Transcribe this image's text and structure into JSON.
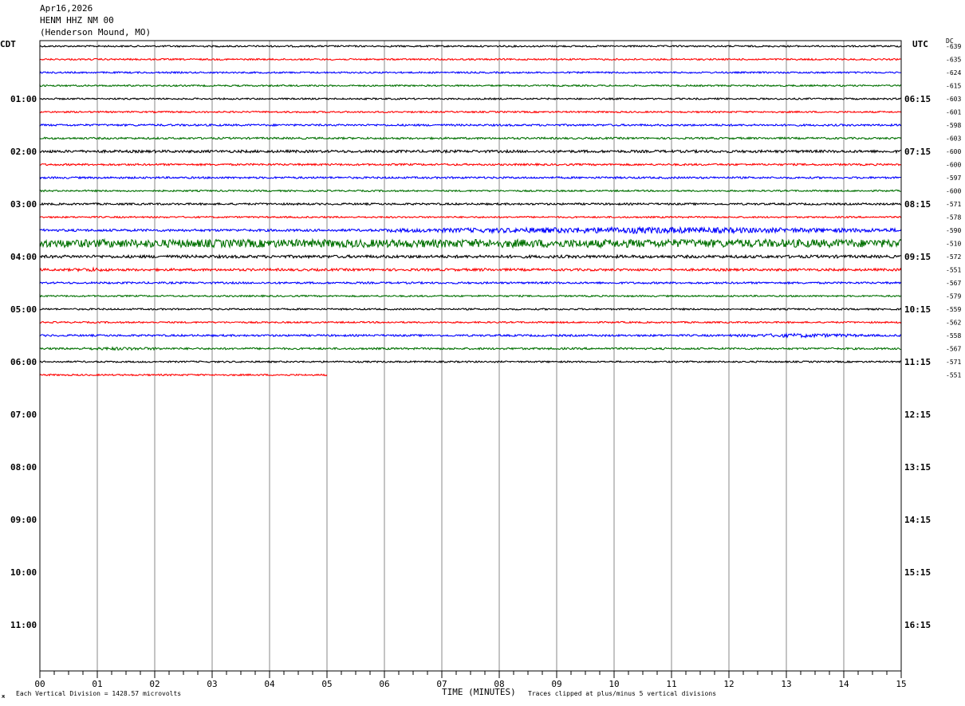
{
  "header": {
    "date": "Apr16,2026",
    "station": "HENM HHZ NM 00",
    "location": "(Henderson Mound, MO)"
  },
  "left_tz_label": "CDT",
  "right_tz_label": "UTC",
  "dc_label": "DC",
  "footer": {
    "vertical_division": "Each Vertical Division = 1428.57 microvolts",
    "axis_title": "TIME (MINUTES)",
    "clipping_note": "Traces clipped at plus/minus 5 vertical divisions",
    "logo_mark": "ж"
  },
  "colors": {
    "trace_cycle": [
      "#000000",
      "#ff0000",
      "#0000ff",
      "#007000"
    ],
    "grid": "#888888",
    "frame": "#000000"
  },
  "chart_data": {
    "type": "line",
    "subtype": "helicorder",
    "x_axis": {
      "label": "TIME (MINUTES)",
      "range": [
        0,
        15
      ],
      "tick_labels": [
        "00",
        "01",
        "02",
        "03",
        "04",
        "05",
        "06",
        "07",
        "08",
        "09",
        "10",
        "11",
        "12",
        "13",
        "14",
        "15"
      ],
      "minor_tick_step": 0.25
    },
    "left_hour_labels": [
      "01:00",
      "02:00",
      "03:00",
      "04:00",
      "05:00",
      "06:00",
      "07:00",
      "08:00",
      "09:00",
      "10:00",
      "11:00"
    ],
    "right_hour_labels": [
      "06:15",
      "07:15",
      "08:15",
      "09:15",
      "10:15",
      "11:15",
      "12:15",
      "13:15",
      "14:15",
      "15:15",
      "16:15"
    ],
    "rows_per_hour": 4,
    "total_rows": 48,
    "traces": [
      {
        "dc": "-639",
        "amp": 1.0,
        "end_min": 15,
        "bursts": []
      },
      {
        "dc": "-635",
        "amp": 1.0,
        "end_min": 15,
        "bursts": []
      },
      {
        "dc": "-624",
        "amp": 1.0,
        "end_min": 15,
        "bursts": []
      },
      {
        "dc": "-615",
        "amp": 1.0,
        "end_min": 15,
        "bursts": []
      },
      {
        "dc": "-603",
        "amp": 1.0,
        "end_min": 15,
        "bursts": []
      },
      {
        "dc": "-601",
        "amp": 1.0,
        "end_min": 15,
        "bursts": []
      },
      {
        "dc": "-598",
        "amp": 1.2,
        "end_min": 15,
        "bursts": []
      },
      {
        "dc": "-603",
        "amp": 1.2,
        "end_min": 15,
        "bursts": []
      },
      {
        "dc": "-600",
        "amp": 1.6,
        "end_min": 15,
        "bursts": []
      },
      {
        "dc": "-600",
        "amp": 1.2,
        "end_min": 15,
        "bursts": []
      },
      {
        "dc": "-597",
        "amp": 1.2,
        "end_min": 15,
        "bursts": []
      },
      {
        "dc": "-600",
        "amp": 1.0,
        "end_min": 15,
        "bursts": []
      },
      {
        "dc": "-571",
        "amp": 1.2,
        "end_min": 15,
        "bursts": []
      },
      {
        "dc": "-578",
        "amp": 1.0,
        "end_min": 15,
        "bursts": []
      },
      {
        "dc": "-590",
        "amp": 1.5,
        "end_min": 15,
        "bursts": [
          [
            6,
            15,
            4.0
          ]
        ]
      },
      {
        "dc": "-510",
        "amp": 5.0,
        "end_min": 15,
        "bursts": []
      },
      {
        "dc": "-572",
        "amp": 1.8,
        "end_min": 15,
        "bursts": []
      },
      {
        "dc": "-551",
        "amp": 1.5,
        "end_min": 15,
        "bursts": [
          [
            0.5,
            1.3,
            2.5
          ],
          [
            7.5,
            8.0,
            2.0
          ]
        ]
      },
      {
        "dc": "-567",
        "amp": 1.2,
        "end_min": 15,
        "bursts": []
      },
      {
        "dc": "-579",
        "amp": 1.0,
        "end_min": 15,
        "bursts": []
      },
      {
        "dc": "-559",
        "amp": 1.0,
        "end_min": 15,
        "bursts": []
      },
      {
        "dc": "-562",
        "amp": 1.0,
        "end_min": 15,
        "bursts": []
      },
      {
        "dc": "-558",
        "amp": 1.2,
        "end_min": 15,
        "bursts": [
          [
            12,
            14.5,
            2.5
          ]
        ]
      },
      {
        "dc": "-567",
        "amp": 1.2,
        "end_min": 15,
        "bursts": [
          [
            0.3,
            2.5,
            2.0
          ]
        ]
      },
      {
        "dc": "-571",
        "amp": 1.0,
        "end_min": 15,
        "bursts": []
      },
      {
        "dc": "-551",
        "amp": 1.0,
        "end_min": 5,
        "bursts": []
      }
    ]
  }
}
